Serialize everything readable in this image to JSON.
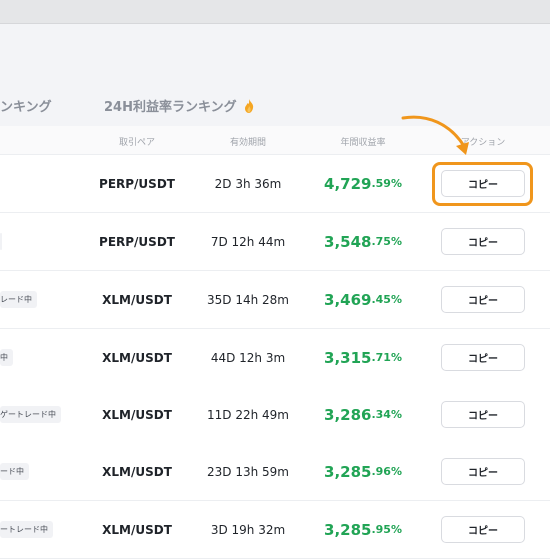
{
  "tabs": {
    "prev_label": "ンキング",
    "active_label": "24H利益率ランキング"
  },
  "columns": {
    "pair": "取引ペア",
    "duration": "有効期間",
    "roi": "年間収益率",
    "action": "アクション"
  },
  "rows": [
    {
      "tag": "",
      "pair": "PERP/USDT",
      "duration": "2D 3h 36m",
      "roi_int": "4,729",
      "roi_dec": ".59%",
      "copy": "コピー"
    },
    {
      "tag": "",
      "pair": "PERP/USDT",
      "duration": "7D 12h 44m",
      "roi_int": "3,548",
      "roi_dec": ".75%",
      "copy": "コピー"
    },
    {
      "tag": "レード中",
      "pair": "XLM/USDT",
      "duration": "35D 14h 28m",
      "roi_int": "3,469",
      "roi_dec": ".45%",
      "copy": "コピー"
    },
    {
      "tag": "中",
      "pair": "XLM/USDT",
      "duration": "44D 12h 3m",
      "roi_int": "3,315",
      "roi_dec": ".71%",
      "copy": "コピー"
    },
    {
      "tag": "ゲートレード中",
      "pair": "XLM/USDT",
      "duration": "11D 22h 49m",
      "roi_int": "3,286",
      "roi_dec": ".34%",
      "copy": "コピー"
    },
    {
      "tag": "ード中",
      "pair": "XLM/USDT",
      "duration": "23D 13h 59m",
      "roi_int": "3,285",
      "roi_dec": ".96%",
      "copy": "コピー"
    },
    {
      "tag": "ートレード中",
      "pair": "XLM/USDT",
      "duration": "3D 19h 32m",
      "roi_int": "3,285",
      "roi_dec": ".95%",
      "copy": "コピー"
    }
  ],
  "colors": {
    "roi_green": "#21a455",
    "highlight_orange": "#f0961c"
  },
  "icons": {
    "flame": "flame-icon",
    "arrow": "curved-arrow-annotation"
  }
}
